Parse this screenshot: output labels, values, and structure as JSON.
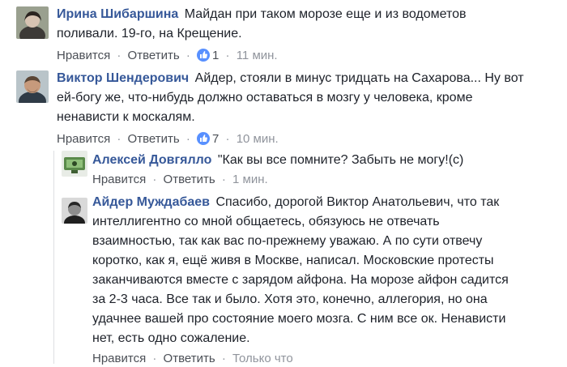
{
  "comments": [
    {
      "author": "Ирина Шибаршина",
      "lines": [
        "Майдан при таком морозе еще и из водометов",
        "поливали. 19-го, на Крещение."
      ],
      "like_label": "Нравится",
      "reply_label": "Ответить",
      "likes": "1",
      "time": "11 мин."
    },
    {
      "author": "Виктор Шендерович",
      "lines": [
        "Айдер, стояли в минус тридцать на Сахарова... Ну вот",
        "ей-богу же, что-нибудь должно оставаться в мозгу у человека, кроме",
        "ненависти к москалям."
      ],
      "like_label": "Нравится",
      "reply_label": "Ответить",
      "likes": "7",
      "time": "10 мин."
    },
    {
      "author": "Алексей Довгялло",
      "lines": [
        "\"Как вы все помните? Забыть не могу!(c)"
      ],
      "like_label": "Нравится",
      "reply_label": "Ответить",
      "time": "1 мин."
    },
    {
      "author": "Айдер Муждабаев",
      "lines": [
        "Спасибо, дорогой Виктор Анатольевич, что так",
        "интеллигентно со мной общаетесь, обязуюсь не отвечать",
        "взаимностью, так как вас по-прежнему уважаю. А по сути отвечу",
        "коротко, как я, ещё живя в Москве, написал. Московские протесты",
        "заканчиваются вместе с зарядом айфона. На морозе айфон садится",
        "за 2-3 часа. Все так и было. Хотя это, конечно, аллегория, но она",
        "удачнее вашей про состояние моего мозга. С ним все ок. Ненависти",
        "нет, есть одно сожаление."
      ],
      "like_label": "Нравится",
      "reply_label": "Ответить",
      "time": "Только что"
    }
  ],
  "separator": "·",
  "colors": {
    "author": "#365899",
    "meta": "#90949c",
    "like_bubble": "#5890ff"
  }
}
